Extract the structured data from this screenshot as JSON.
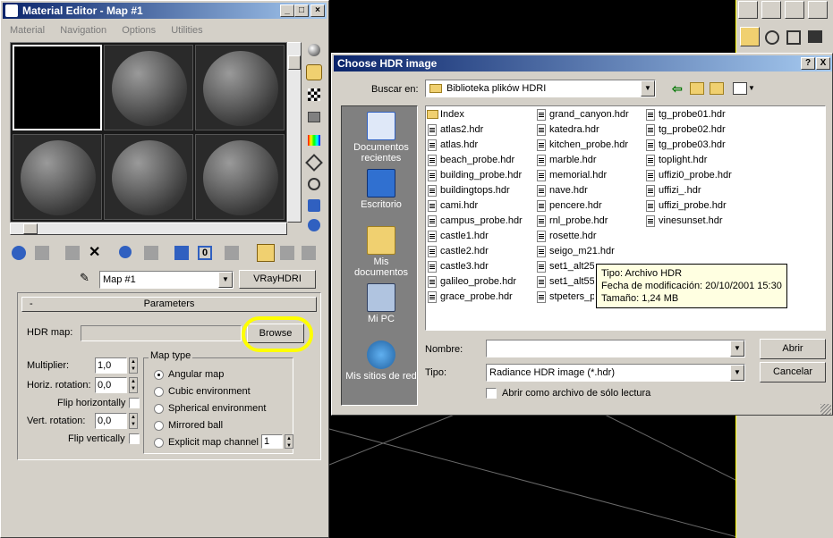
{
  "material_editor": {
    "title": "Material Editor - Map #1",
    "menu": [
      "Material",
      "Navigation",
      "Options",
      "Utilities"
    ],
    "map_name": "Map #1",
    "map_type_button": "VRayHDRI",
    "rollout_toggle": "-",
    "rollout_title": "Parameters",
    "hdr_map_label": "HDR map:",
    "browse_label": "Browse",
    "multiplier_label": "Multiplier:",
    "multiplier_value": "1,0",
    "horiz_rotation_label": "Horiz. rotation:",
    "horiz_rotation_value": "0,0",
    "flip_horizontally_label": "Flip horizontally",
    "vert_rotation_label": "Vert. rotation:",
    "vert_rotation_value": "0,0",
    "flip_vertically_label": "Flip vertically",
    "map_type_group": "Map type",
    "map_types": [
      "Angular map",
      "Cubic environment",
      "Spherical environment",
      "Mirrored ball",
      "Explicit map channel"
    ],
    "selected_map_type": "Angular map",
    "map_channel_value": "1",
    "highlight_color": "#ffff00"
  },
  "dialog": {
    "title": "Choose HDR image",
    "help": "?",
    "close": "X",
    "look_in_label": "Buscar en:",
    "look_in_value": "Biblioteka plików HDRI",
    "places": [
      "Documentos recientes",
      "Escritorio",
      "Mis documentos",
      "Mi PC",
      "Mis sitios de red"
    ],
    "files_col1": [
      "Index",
      "atlas2.hdr",
      "atlas.hdr",
      "beach_probe.hdr",
      "building_probe.hdr",
      "buildingtops.hdr",
      "cami.hdr",
      "campus_probe.hdr",
      "castle1.hdr",
      "castle2.hdr",
      "castle3.hdr",
      "galileo_probe.hdr",
      "grace_probe.hdr"
    ],
    "files_col2": [
      "grand_canyon.hdr",
      "katedra.hdr",
      "kitchen_probe.hdr",
      "marble.hdr",
      "memorial.hdr",
      "nave.hdr",
      "pencere.hdr",
      "rnl_probe.hdr",
      "rosette.hdr",
      "seigo_m21.hdr",
      "set1_alt25.hdr",
      "set1_alt55.hdr",
      "stpeters_probe.hdr"
    ],
    "files_col3": [
      "tg_probe01.hdr",
      "tg_probe02.hdr",
      "tg_probe03.hdr",
      "toplight.hdr",
      "uffizi0_probe.hdr",
      "uffizi_.hdr",
      "uffizi_probe.hdr",
      "vinesunset.hdr"
    ],
    "tooltip": [
      "Tipo: Archivo HDR",
      "Fecha de modificación: 20/10/2001 15:30",
      "Tamaño: 1,24 MB"
    ],
    "filename_label": "Nombre:",
    "filename_value": "",
    "filetype_label": "Tipo:",
    "filetype_value": "Radiance HDR image (*.hdr)",
    "readonly_label": "Abrir como archivo de sólo lectura",
    "open_button": "Abrir",
    "cancel_button": "Cancelar"
  }
}
